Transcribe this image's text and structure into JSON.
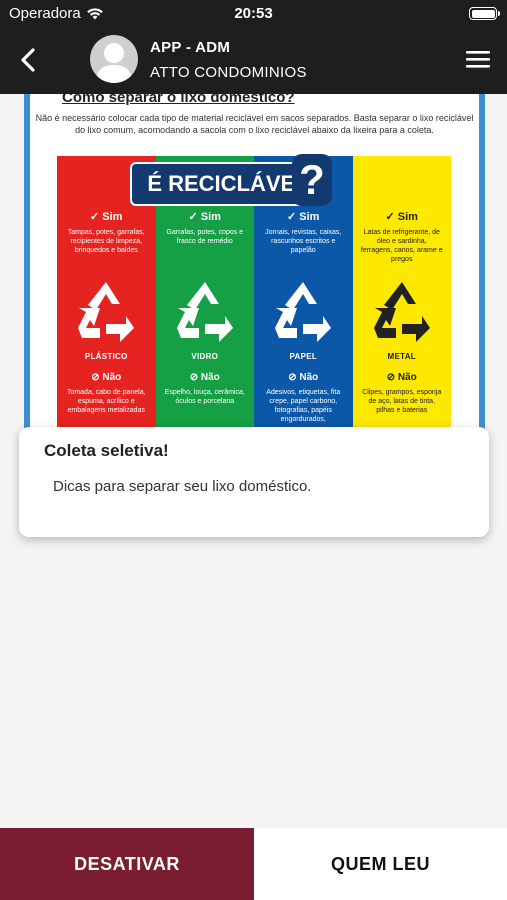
{
  "status_bar": {
    "carrier": "Operadora",
    "time": "20:53"
  },
  "header": {
    "title": "APP - ADM",
    "subtitle": "ATTO CONDOMINIOS"
  },
  "poster": {
    "heading": "Como separar o lixo doméstico?",
    "intro": "Não é necessário colocar cada tipo de material reciclável em sacos separados. Basta separar o lixo reciclável do lixo comum, acomodando a sacola com o lixo reciclável abaixo da lixeira para a coleta.",
    "banner": "É RECICLÁVEL",
    "banner_mark": "?",
    "yes_label": "✓ Sim",
    "no_label": "⊘ Não",
    "columns": [
      {
        "material": "PLÁSTICO",
        "yes": "Tampas, potes, garrafas, recipientes de limpeza, brinquedos e baldes",
        "no": "Tomada, cabo de panela, espuma, acrílico e embalagens metalizadas",
        "color": "#e52421"
      },
      {
        "material": "VIDRO",
        "yes": "Garrafas, potes, copos e frasco de remédio",
        "no": "Espelho, louça, cerâmica, óculos e porcelana",
        "color": "#15a045"
      },
      {
        "material": "PAPEL",
        "yes": "Jornais, revistas, caixas, rascunhos escritos e papelão",
        "no": "Adesivos, etiquetas, fita crepe, papel carbono, fotografias, papéis engordurados,",
        "color": "#0c58a8"
      },
      {
        "material": "METAL",
        "yes": "Latas de refrigerante, de óleo e sardinha, ferragens, canos, arame e pregos",
        "no": "Clipes, grampos, esponja de aço, latas de tinta, pilhas e baterias",
        "color": "#fde800"
      }
    ]
  },
  "card": {
    "title": "Coleta seletiva!",
    "description": "Dicas para separar seu lixo doméstico."
  },
  "buttons": {
    "deactivate": "DESATIVAR",
    "who_read": "QUEM LEU"
  },
  "colors": {
    "header_bg": "#1e1e1e",
    "accent": "#7a1d30"
  },
  "icons": {
    "back": "chevron-left-icon",
    "menu": "hamburger-menu-icon",
    "avatar": "user-avatar-icon",
    "wifi": "wifi-icon",
    "battery": "battery-icon",
    "recycle": "recycle-icon"
  }
}
